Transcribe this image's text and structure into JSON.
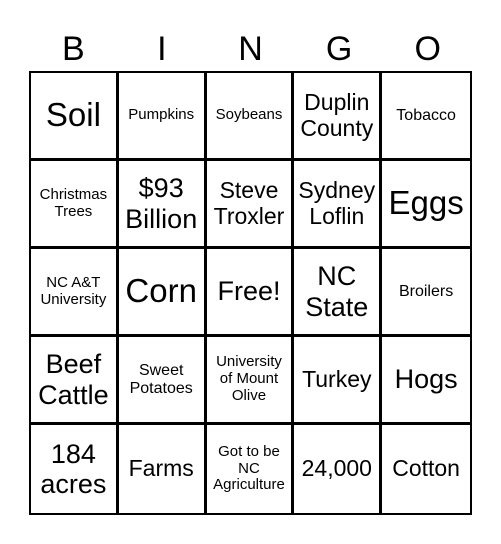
{
  "header": {
    "letters": [
      "B",
      "I",
      "N",
      "G",
      "O"
    ]
  },
  "card": {
    "rows": [
      [
        {
          "text": "Soil",
          "size": "xl"
        },
        {
          "text": "Pumpkins",
          "size": "xs"
        },
        {
          "text": "Soybeans",
          "size": "xs"
        },
        {
          "text": "Duplin\nCounty",
          "size": "md"
        },
        {
          "text": "Tobacco",
          "size": "sm"
        }
      ],
      [
        {
          "text": "Christmas\nTrees",
          "size": "xs"
        },
        {
          "text": "$93\nBillion",
          "size": "lg"
        },
        {
          "text": "Steve\nTroxler",
          "size": "md"
        },
        {
          "text": "Sydney\nLoflin",
          "size": "md"
        },
        {
          "text": "Eggs",
          "size": "xl"
        }
      ],
      [
        {
          "text": "NC A&T\nUniversity",
          "size": "xs"
        },
        {
          "text": "Corn",
          "size": "xl"
        },
        {
          "text": "Free!",
          "size": "lg"
        },
        {
          "text": "NC\nState",
          "size": "lg"
        },
        {
          "text": "Broilers",
          "size": "sm"
        }
      ],
      [
        {
          "text": "Beef\nCattle",
          "size": "lg"
        },
        {
          "text": "Sweet\nPotatoes",
          "size": "sm"
        },
        {
          "text": "University\nof Mount\nOlive",
          "size": "xs"
        },
        {
          "text": "Turkey",
          "size": "md"
        },
        {
          "text": "Hogs",
          "size": "lg"
        }
      ],
      [
        {
          "text": "184\nacres",
          "size": "lg"
        },
        {
          "text": "Farms",
          "size": "md"
        },
        {
          "text": "Got to be\nNC\nAgriculture",
          "size": "xs"
        },
        {
          "text": "24,000",
          "size": "md"
        },
        {
          "text": "Cotton",
          "size": "md"
        }
      ]
    ]
  }
}
